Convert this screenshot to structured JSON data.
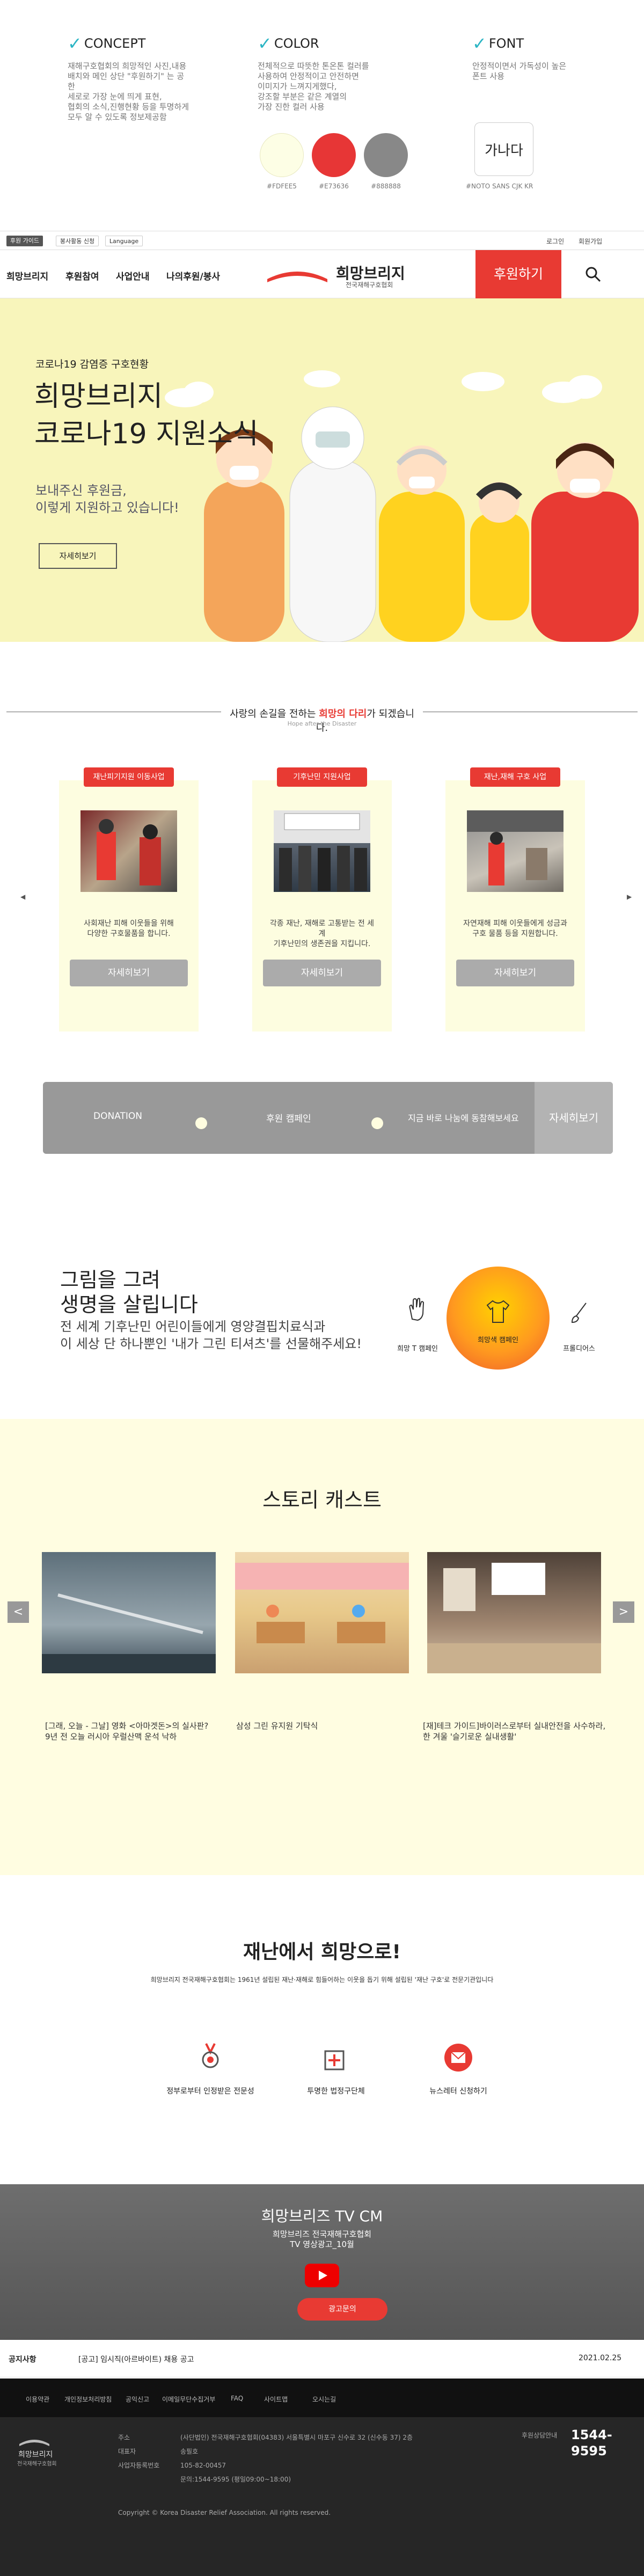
{
  "concept": {
    "title": "CONCEPT",
    "desc": "재해구호협회의 희망적인 사진,내용\n배치와 메인 상단 \"후원하기\" 는 공한\n세로로 가장 눈에 띄게 표현,\n협회의 소식,진행현황 등을 투명하게\n모두 알 수 있도록 정보제공함"
  },
  "color": {
    "title": "COLOR",
    "desc": "전체적으로 따뜻한 톤온톤 컬러를\n사용하여 안정적이고 안전하면\n이미지가 느껴지게했다,\n강조할 부분은 같은 계열의\n가장 진한 컬러 사용",
    "swatches": [
      {
        "hex": "#FDFEE5",
        "label": "#FDFEE5"
      },
      {
        "hex": "#E73636",
        "label": "#E73636"
      },
      {
        "hex": "#888888",
        "label": "#888888"
      }
    ]
  },
  "font": {
    "title": "FONT",
    "desc": "안정적이면서 가독성이 높은\n폰트 사용",
    "sample": "가나다",
    "name": "#NOTO SANS CJK KR"
  },
  "util": {
    "btn1": "후원 가이드",
    "btn2": "봉사활동 신청",
    "btn3": "Language",
    "login": "로그인",
    "join": "회원가입"
  },
  "nav": {
    "items": [
      "희망브리지",
      "후원참여",
      "사업안내",
      "나의후원/봉사"
    ],
    "logo_main": "희망브리지",
    "logo_sub": "전국재해구호협회",
    "donate": "후원하기",
    "search_icon": "search-icon"
  },
  "hero": {
    "small": "코로나19 감염증 구호현황",
    "title": "희망브리지\n코로나19 지원소식",
    "sub": "보내주신 후원금,\n이렇게 지원하고 있습니다!",
    "btn": "자세히보기"
  },
  "support": {
    "title_pre": "사랑의 손길을 전하는 ",
    "title_em": "희망의 다리",
    "title_post": "가 되겠습니다.",
    "subtitle": "Hope after the Disaster",
    "cards": [
      {
        "badge": "재난피기지원 이동사업",
        "text": "사회재난 피해 이웃들을 위해\n다양한 구호물품을 합니다.",
        "btn": "자세히보기"
      },
      {
        "badge": "기후난민 지원사업",
        "text": "각종 재난, 재해로 고통받는 전 세계\n기후난민의 생존권을 지킵니다.",
        "btn": "자세히보기"
      },
      {
        "badge": "재난,재해 구호 사업",
        "text": "자연재해 피해 이웃들에게 성금과\n구호 물품 등을 지원합니다.",
        "btn": "자세히보기"
      }
    ]
  },
  "donation_bar": {
    "a": "DONATION",
    "b": "후원 캠페인",
    "c": "지금 바로 나눔에 동참해보세요",
    "more": "자세히보기"
  },
  "draw": {
    "title": "그림을 그려\n생명을 살립니다",
    "sub": "전 세계 기후난민 어린이들에게 영양결핍치료식과\n이 세상 단 하나뿐인 '내가 그린 티셔츠'를 선물해주세요!",
    "icons": [
      {
        "icon": "hand-icon",
        "label": "희망 T 캠페인"
      },
      {
        "icon": "tshirt-icon",
        "label": "희망색 캠페인"
      },
      {
        "icon": "brush-icon",
        "label": "프롤디어스"
      }
    ]
  },
  "story": {
    "title": "스토리 캐스트",
    "items": [
      {
        "caption": "[그래, 오늘 - 그날] 영화 <아마겟돈>의 실사판?\n9년 전 오늘 러시아 우럴산맥 운석 낙하"
      },
      {
        "caption": "삼성 그린 유지원 기탁식"
      },
      {
        "caption": "[재]테크 가이드]바이러스로부터 실내안전을 사수하라,\n한 겨울 '슬기로운 실내생활'"
      }
    ]
  },
  "from_disaster": {
    "title": "재난에서 희망으로!",
    "desc": "희망브리지 전국재해구호협회는 1961년 설립된 재난·재해로 힘들어하는 이웃을 돕기 위해 설립된 '재난 구호'로 전문기관입니다",
    "items": [
      {
        "icon": "medal-icon",
        "label": "정부로부터 인정받은 전문성"
      },
      {
        "icon": "box-icon",
        "label": "투명한 법정구단체"
      },
      {
        "icon": "newsletter-icon",
        "label": "뉴스레터 신청하기"
      }
    ]
  },
  "tv": {
    "title": "희망브리즈 TV CM",
    "sub": "희망브리즈 전국재해구호협회\nTV 영상광고_10월",
    "btn": "광고문의"
  },
  "notice": {
    "label": "공지사항",
    "text": "[공고] 임시직(아르바이트) 채용 공고",
    "date": "2021.02.25"
  },
  "footer_nav": [
    "이용약관",
    "개인정보처리방침",
    "공익신고",
    "이메일무단수집거부",
    "FAQ",
    "사이트맵",
    "오시는길"
  ],
  "footer": {
    "logo_main": "희망브리지",
    "logo_sub": "전국재해구호협회",
    "rows": [
      {
        "k": "주소",
        "v": "(사단법인) 전국재해구호협회(04383) 서울특별시 마포구 신수로 32 (신수동 37) 2층"
      },
      {
        "k": "대표자",
        "v": "송필호"
      },
      {
        "k": "사업자등록번호",
        "v": "105-82-00457"
      },
      {
        "k": "",
        "v": "문의:1544-9595 (평일09:00~18:00)"
      }
    ],
    "call_label": "후원상담안내",
    "phone": "1544-9595",
    "copyright": "Copyright © Korea Disaster Relief Association. All rights reserved."
  },
  "colors": {
    "accent": "#E83A33",
    "cream": "#FDFEE5",
    "gray": "#888888",
    "check": "#2BB5C4"
  }
}
